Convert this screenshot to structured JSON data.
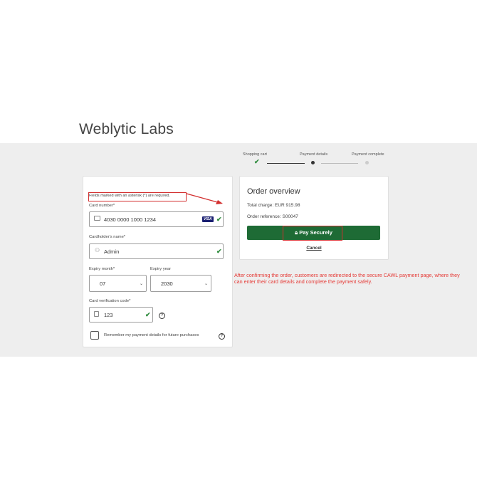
{
  "brand": "Weblytic Labs",
  "steps": [
    {
      "label": "Shopping cart",
      "state": "done"
    },
    {
      "label": "Payment details",
      "state": "current"
    },
    {
      "label": "Payment complete",
      "state": "pending"
    }
  ],
  "form": {
    "required_note": "Fields marked with an asterisk (*) are required.",
    "card_number_label": "Card number*",
    "card_number_value": "4030 0000 1000 1234",
    "card_brand": "VISA",
    "holder_label": "Cardholder's name*",
    "holder_value": "Admin",
    "expiry_month_label": "Expiry month*",
    "expiry_month_value": "07",
    "expiry_year_label": "Expiry year",
    "expiry_year_value": "2030",
    "cvc_label": "Card verification code*",
    "cvc_value": "123",
    "remember_label": "Remember my payment details for future purchases",
    "help_glyph": "?"
  },
  "overview": {
    "title": "Order overview",
    "total": "Total charge: EUR 915.98",
    "reference": "Order reference: S00047",
    "pay_label": "Pay Securely",
    "cancel_label": "Cancel"
  },
  "annotation": "After confirming the order, customers are redirected to the secure CAWL payment page, where they can enter their card details and complete the payment safely.",
  "colors": {
    "accent": "#1e6b35",
    "check": "#2e8b3d",
    "highlight": "#d32f2f",
    "annotation": "#e53935"
  }
}
